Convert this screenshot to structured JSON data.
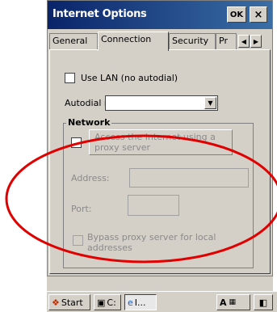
{
  "window": {
    "title": "Internet Options",
    "ok_label": "OK",
    "close_label": "×"
  },
  "tabs": [
    {
      "label": "General"
    },
    {
      "label": "Connection"
    },
    {
      "label": "Security"
    },
    {
      "label": "Pr"
    }
  ],
  "tab_scroll": {
    "left": "◀",
    "right": "▶"
  },
  "connection": {
    "use_lan_label": "Use LAN (no autodial)",
    "autodial_label": "Autodial name:",
    "autodial_value": "",
    "network_group_title": "Network",
    "proxy_button_label_line1": "Access the Internet using a",
    "proxy_button_label_line2": "proxy server",
    "address_label": "Address:",
    "address_value": "",
    "port_label": "Port:",
    "port_value": "",
    "bypass_label_line1": "Bypass proxy server for local",
    "bypass_label_line2": "addresses"
  },
  "taskbar": {
    "start_label": "Start",
    "item1_label": "C:",
    "item2_label": "I...",
    "tray_label": "A"
  },
  "annotation": {
    "color": "#e00000"
  }
}
